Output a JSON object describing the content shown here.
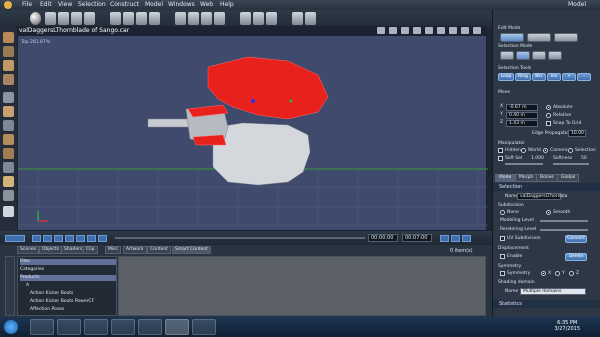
{
  "menubar": {
    "items": [
      "File",
      "Edit",
      "View",
      "Selection",
      "Construct",
      "Model",
      "Windows",
      "Web",
      "Help"
    ],
    "mode": "Model"
  },
  "viewport": {
    "title": "valDaggersLThornblade of Sango.car",
    "zoom": "Top 281.87%"
  },
  "timeline": {
    "time_start": "00:00:00",
    "time_end": "00:07:00"
  },
  "library": {
    "tabs": [
      "Scenes",
      "Objects",
      "Shaders",
      "Clip",
      "Misc",
      "Artwork",
      "Content",
      "Smart Content"
    ],
    "tree": [
      "Files",
      "Categories",
      "Products",
      "A",
      "Action Kicker Boots",
      "Action Kicker Boots PowerCF",
      "Affection Poses"
    ],
    "count": "0 item(s)"
  },
  "edit_mode": {
    "header": "Edit Mode",
    "selection_mode": "Selection Mode",
    "selection_tools": "Selection Tools",
    "tool_buttons": [
      "Loop",
      "Ring",
      "Bkr",
      "Inv",
      "+",
      "-"
    ],
    "move": "Move",
    "x": "-0.67 m",
    "y": "0.40 m",
    "z": "1.43 m",
    "absolute": "Absolute",
    "relative": "Relative",
    "snap": "Snap To Grid",
    "edge_propagation_label": "Edge Propagation",
    "edge_propagation": "10.00"
  },
  "manipulator": {
    "header": "Manipulator",
    "hidden": "Hidden",
    "world": "World",
    "camera": "Camera",
    "selection": "Selection",
    "soft_sel": "Soft Sel",
    "soft_val": "1.000",
    "softness": "Softness",
    "softness_val": "50"
  },
  "right_tabs": [
    "Mode",
    "Morph",
    "Bones",
    "Global"
  ],
  "selection_panel": {
    "header": "Selection",
    "name_label": "Name",
    "name_value": "valDaggersLThornbla",
    "subdivision": "Subdivision",
    "none": "None",
    "smooth": "Smooth",
    "modeling_level": "Modeling Level",
    "rendering_level": "Rendering Level",
    "uv_subdiv": "UV Subdivision",
    "convert": "Convert",
    "displacement": "Displacement",
    "enable": "Enable",
    "delete": "Delete",
    "symmetry": "Symmetry",
    "sym_check": "Symmetry",
    "axes": [
      "X",
      "Y",
      "Z"
    ],
    "shading_domain": "Shading domain",
    "name2": "Name",
    "domain_value": "Multiple domains",
    "statistics": "Statistics"
  },
  "taskbar": {
    "time": "6:35 PM",
    "date": "3/27/2015"
  }
}
